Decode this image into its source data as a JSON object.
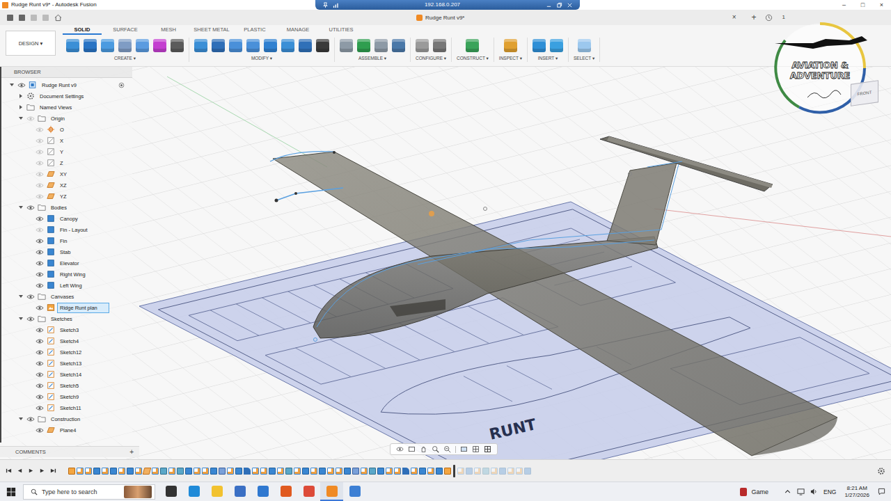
{
  "titlebar": {
    "title": "Rudge Runt v9* - Autodesk Fusion",
    "remote": "192.168.0.207",
    "controls": [
      "–",
      "□",
      "×"
    ]
  },
  "doc_tab": {
    "label": "Rudge Runt v9*",
    "close": "×",
    "new": "+",
    "badge": "1"
  },
  "workspace_button": "DESIGN ▾",
  "toolbar_tabs": [
    {
      "label": "SOLID",
      "selected": true
    },
    {
      "label": "SURFACE",
      "selected": false
    },
    {
      "label": "MESH",
      "selected": false
    },
    {
      "label": "SHEET METAL",
      "selected": false
    },
    {
      "label": "PLASTIC",
      "selected": false
    },
    {
      "label": "MANAGE",
      "selected": false
    },
    {
      "label": "UTILITIES",
      "selected": false
    }
  ],
  "tool_groups": [
    {
      "label": "CREATE ▾"
    },
    {
      "label": "MODIFY ▾"
    },
    {
      "label": "ASSEMBLE ▾"
    },
    {
      "label": "CONFIGURE ▾"
    },
    {
      "label": "CONSTRUCT ▾"
    },
    {
      "label": "INSPECT ▾"
    },
    {
      "label": "INSERT ▾"
    },
    {
      "label": "SELECT ▾"
    }
  ],
  "browser": {
    "title": "BROWSER",
    "items": [
      {
        "label": "Rudge Runt v9",
        "depth": 0,
        "kind": "component",
        "caret": "open",
        "eye": "shown",
        "selected": false
      },
      {
        "label": "Document Settings",
        "depth": 1,
        "kind": "settings",
        "caret": "closed",
        "eye": "none",
        "selected": false
      },
      {
        "label": "Named Views",
        "depth": 1,
        "kind": "folder",
        "caret": "closed",
        "eye": "none",
        "selected": false
      },
      {
        "label": "Origin",
        "depth": 1,
        "kind": "folder",
        "caret": "open",
        "eye": "hidden",
        "selected": false
      },
      {
        "label": "O",
        "depth": 2,
        "kind": "point",
        "caret": "none",
        "eye": "hidden",
        "selected": false
      },
      {
        "label": "X",
        "depth": 2,
        "kind": "axis",
        "caret": "none",
        "eye": "hidden",
        "selected": false
      },
      {
        "label": "Y",
        "depth": 2,
        "kind": "axis",
        "caret": "none",
        "eye": "hidden",
        "selected": false
      },
      {
        "label": "Z",
        "depth": 2,
        "kind": "axis",
        "caret": "none",
        "eye": "hidden",
        "selected": false
      },
      {
        "label": "XY",
        "depth": 2,
        "kind": "plane",
        "caret": "none",
        "eye": "hidden",
        "selected": false
      },
      {
        "label": "XZ",
        "depth": 2,
        "kind": "plane",
        "caret": "none",
        "eye": "hidden",
        "selected": false
      },
      {
        "label": "YZ",
        "depth": 2,
        "kind": "plane",
        "caret": "none",
        "eye": "hidden",
        "selected": false
      },
      {
        "label": "Bodies",
        "depth": 1,
        "kind": "folder",
        "caret": "open",
        "eye": "shown",
        "selected": false
      },
      {
        "label": "Canopy",
        "depth": 2,
        "kind": "body",
        "caret": "none",
        "eye": "shown",
        "selected": false
      },
      {
        "label": "Fin - Layout",
        "depth": 2,
        "kind": "body",
        "caret": "none",
        "eye": "hidden",
        "selected": false
      },
      {
        "label": "Fin",
        "depth": 2,
        "kind": "body",
        "caret": "none",
        "eye": "shown",
        "selected": false
      },
      {
        "label": "Stab",
        "depth": 2,
        "kind": "body",
        "caret": "none",
        "eye": "shown",
        "selected": false
      },
      {
        "label": "Elevator",
        "depth": 2,
        "kind": "body",
        "caret": "none",
        "eye": "shown",
        "selected": false
      },
      {
        "label": "Right Wing",
        "depth": 2,
        "kind": "body",
        "caret": "none",
        "eye": "shown",
        "selected": false
      },
      {
        "label": "Left Wing",
        "depth": 2,
        "kind": "body",
        "caret": "none",
        "eye": "shown",
        "selected": false
      },
      {
        "label": "Canvases",
        "depth": 1,
        "kind": "folder",
        "caret": "open",
        "eye": "shown",
        "selected": false
      },
      {
        "label": "Ridge Runt plan",
        "depth": 2,
        "kind": "canvas",
        "caret": "none",
        "eye": "shown",
        "selected": true
      },
      {
        "label": "Sketches",
        "depth": 1,
        "kind": "folder",
        "caret": "open",
        "eye": "shown",
        "selected": false
      },
      {
        "label": "Sketch3",
        "depth": 2,
        "kind": "sketch",
        "caret": "none",
        "eye": "shown",
        "selected": false
      },
      {
        "label": "Sketch4",
        "depth": 2,
        "kind": "sketch",
        "caret": "none",
        "eye": "shown",
        "selected": false
      },
      {
        "label": "Sketch12",
        "depth": 2,
        "kind": "sketch",
        "caret": "none",
        "eye": "shown",
        "selected": false
      },
      {
        "label": "Sketch13",
        "depth": 2,
        "kind": "sketch",
        "caret": "none",
        "eye": "shown",
        "selected": false
      },
      {
        "label": "Sketch14",
        "depth": 2,
        "kind": "sketch",
        "caret": "none",
        "eye": "shown",
        "selected": false
      },
      {
        "label": "Sketch5",
        "depth": 2,
        "kind": "sketch",
        "caret": "none",
        "eye": "shown",
        "selected": false
      },
      {
        "label": "Sketch9",
        "depth": 2,
        "kind": "sketch",
        "caret": "none",
        "eye": "shown",
        "selected": false
      },
      {
        "label": "Sketch11",
        "depth": 2,
        "kind": "sketch",
        "caret": "none",
        "eye": "shown",
        "selected": false
      },
      {
        "label": "Construction",
        "depth": 1,
        "kind": "folder",
        "caret": "open",
        "eye": "shown",
        "selected": false
      },
      {
        "label": "Plane4",
        "depth": 2,
        "kind": "plane",
        "caret": "none",
        "eye": "shown",
        "selected": false
      }
    ]
  },
  "logo": {
    "line1": "AVIATION &",
    "line2": "ADVENTURE"
  },
  "viewcube": {
    "face": "FRONT"
  },
  "plan_text": "RUNT",
  "comments": {
    "title": "COMMENTS",
    "add": "+"
  },
  "timeline": {
    "features": [
      {
        "kind": "canvas",
        "rolled": false
      },
      {
        "kind": "sketch",
        "rolled": false
      },
      {
        "kind": "sketch",
        "rolled": false
      },
      {
        "kind": "extrude",
        "rolled": false
      },
      {
        "kind": "sketch",
        "rolled": false
      },
      {
        "kind": "extrude",
        "rolled": false
      },
      {
        "kind": "sketch",
        "rolled": false
      },
      {
        "kind": "extrude",
        "rolled": false
      },
      {
        "kind": "sketch",
        "rolled": false
      },
      {
        "kind": "plane",
        "rolled": false
      },
      {
        "kind": "sketch",
        "rolled": false
      },
      {
        "kind": "loft",
        "rolled": false
      },
      {
        "kind": "sketch",
        "rolled": false
      },
      {
        "kind": "loft",
        "rolled": false
      },
      {
        "kind": "extrude",
        "rolled": false
      },
      {
        "kind": "sketch",
        "rolled": false
      },
      {
        "kind": "sketch",
        "rolled": false
      },
      {
        "kind": "extrude",
        "rolled": false
      },
      {
        "kind": "mirror",
        "rolled": false
      },
      {
        "kind": "sketch",
        "rolled": false
      },
      {
        "kind": "extrude",
        "rolled": false
      },
      {
        "kind": "fillet",
        "rolled": false
      },
      {
        "kind": "sketch",
        "rolled": false
      },
      {
        "kind": "sketch",
        "rolled": false
      },
      {
        "kind": "extrude",
        "rolled": false
      },
      {
        "kind": "sketch",
        "rolled": false
      },
      {
        "kind": "loft",
        "rolled": false
      },
      {
        "kind": "sketch",
        "rolled": false
      },
      {
        "kind": "extrude",
        "rolled": false
      },
      {
        "kind": "sketch",
        "rolled": false
      },
      {
        "kind": "extrude",
        "rolled": false
      },
      {
        "kind": "sketch",
        "rolled": false
      },
      {
        "kind": "sketch",
        "rolled": false
      },
      {
        "kind": "extrude",
        "rolled": false
      },
      {
        "kind": "mirror",
        "rolled": false
      },
      {
        "kind": "sketch",
        "rolled": false
      },
      {
        "kind": "loft",
        "rolled": false
      },
      {
        "kind": "extrude",
        "rolled": false
      },
      {
        "kind": "sketch",
        "rolled": false
      },
      {
        "kind": "sketch",
        "rolled": false
      },
      {
        "kind": "fillet",
        "rolled": false
      },
      {
        "kind": "sketch",
        "rolled": false
      },
      {
        "kind": "extrude",
        "rolled": false
      },
      {
        "kind": "sketch",
        "rolled": false
      },
      {
        "kind": "extrude",
        "rolled": false
      },
      {
        "kind": "canvas",
        "rolled": false
      },
      {
        "kind": "sketch",
        "rolled": true
      },
      {
        "kind": "extrude",
        "rolled": true
      },
      {
        "kind": "sketch",
        "rolled": true
      },
      {
        "kind": "loft",
        "rolled": true
      },
      {
        "kind": "sketch",
        "rolled": true
      },
      {
        "kind": "extrude",
        "rolled": true
      },
      {
        "kind": "sketch",
        "rolled": true
      },
      {
        "kind": "sketch",
        "rolled": true
      },
      {
        "kind": "extrude",
        "rolled": true
      }
    ]
  },
  "taskbar": {
    "search_placeholder": "Type here to search",
    "apps": [
      {
        "kind": "taskview",
        "active": false
      },
      {
        "kind": "edge",
        "active": false
      },
      {
        "kind": "explorer",
        "active": false
      },
      {
        "kind": "store",
        "active": false
      },
      {
        "kind": "mail",
        "active": false
      },
      {
        "kind": "media",
        "active": false
      },
      {
        "kind": "chrome",
        "active": false
      },
      {
        "kind": "fusion",
        "active": true
      },
      {
        "kind": "other",
        "active": false
      }
    ],
    "tray_label": "Game",
    "language": "ENG",
    "time": "8:21 AM",
    "date": "1/27/2026"
  }
}
